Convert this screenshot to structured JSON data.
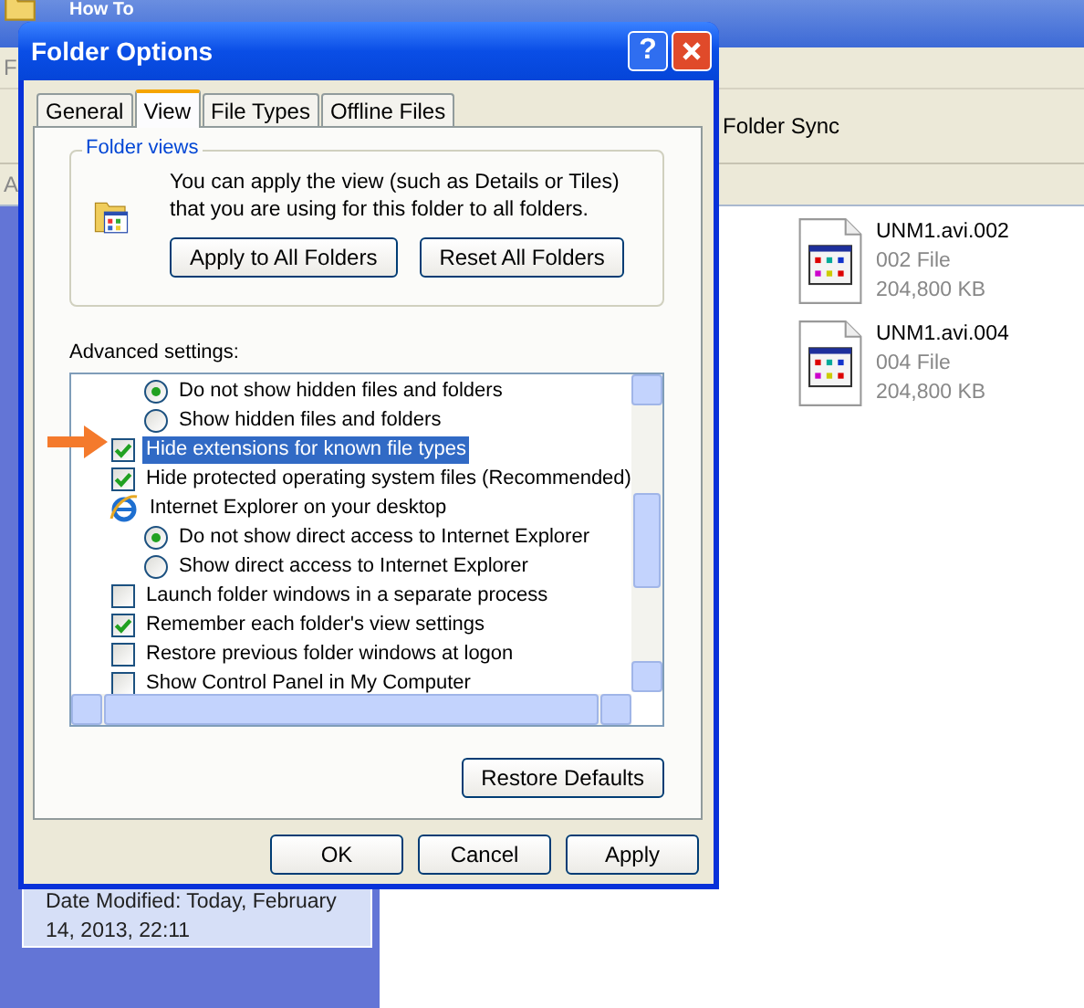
{
  "explorer": {
    "title": "How To",
    "menu_fragment": "F",
    "address_fragment": "A",
    "toolbar_label": "Folder Sync",
    "files": [
      {
        "name": "UNM1.avi.002",
        "type": "002 File",
        "size": "204,800 KB"
      },
      {
        "name": "UNM1.avi.004",
        "type": "004 File",
        "size": "204,800 KB"
      }
    ],
    "details": "Date Modified: Today, February 14, 2013, 22:11"
  },
  "dialog": {
    "title": "Folder Options",
    "help": "?",
    "tabs": [
      {
        "label": "General",
        "selected": false
      },
      {
        "label": "View",
        "selected": true
      },
      {
        "label": "File Types",
        "selected": false
      },
      {
        "label": "Offline Files",
        "selected": false
      }
    ],
    "folder_views": {
      "legend": "Folder views",
      "text": "You can apply the view (such as Details or Tiles) that you are using for this folder to all folders.",
      "buttons": [
        "Apply to All Folders",
        "Reset All Folders"
      ]
    },
    "advanced_label": "Advanced settings:",
    "settings": [
      {
        "kind": "radio",
        "label": "Do not show hidden files and folders",
        "checked": true,
        "selected": false
      },
      {
        "kind": "radio",
        "label": "Show hidden files and folders",
        "checked": false,
        "selected": false
      },
      {
        "kind": "checkbox",
        "label": "Hide extensions for known file types",
        "checked": true,
        "selected": true,
        "pointed": true
      },
      {
        "kind": "checkbox",
        "label": "Hide protected operating system files (Recommended)",
        "checked": true,
        "selected": false
      },
      {
        "kind": "group",
        "label": "Internet Explorer on your desktop",
        "selected": false,
        "children": [
          {
            "kind": "radio",
            "label": "Do not show direct access to Internet Explorer",
            "checked": true,
            "selected": false
          },
          {
            "kind": "radio",
            "label": "Show direct access to Internet Explorer",
            "checked": false,
            "selected": false
          }
        ]
      },
      {
        "kind": "checkbox",
        "label": "Launch folder windows in a separate process",
        "checked": false,
        "selected": false
      },
      {
        "kind": "checkbox",
        "label": "Remember each folder's view settings",
        "checked": true,
        "selected": false
      },
      {
        "kind": "checkbox",
        "label": "Restore previous folder windows at logon",
        "checked": false,
        "selected": false
      },
      {
        "kind": "checkbox",
        "label": "Show Control Panel in My Computer",
        "checked": false,
        "selected": false
      }
    ],
    "restore_button": "Restore Defaults",
    "buttons": [
      "OK",
      "Cancel",
      "Apply"
    ]
  }
}
